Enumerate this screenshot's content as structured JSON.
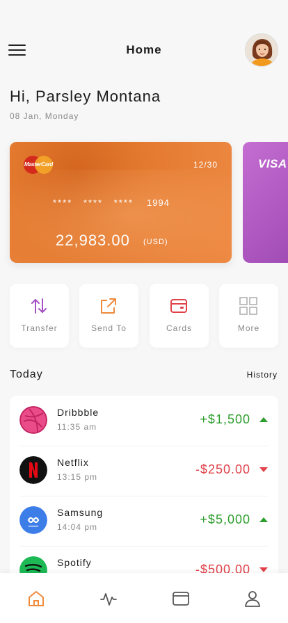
{
  "header": {
    "title": "Home"
  },
  "greeting": {
    "text": "Hi, Parsley Montana",
    "date": "08 Jan, Monday"
  },
  "cards": [
    {
      "brand": "MasterCard",
      "expiry": "12/30",
      "masked": "**** **** ****",
      "last4": "1994",
      "balance": "22,983.00",
      "currency": "(USD)"
    },
    {
      "brand": "VISA"
    }
  ],
  "actions": [
    {
      "label": "Transfer",
      "icon": "transfer-icon"
    },
    {
      "label": "Send To",
      "icon": "send-to-icon"
    },
    {
      "label": "Cards",
      "icon": "cards-icon"
    },
    {
      "label": "More",
      "icon": "more-grid-icon"
    }
  ],
  "today": {
    "title": "Today",
    "history_label": "History"
  },
  "transactions": [
    {
      "name": "Dribbble",
      "time": "11:35 am",
      "amount": "+$1,500",
      "direction": "up"
    },
    {
      "name": "Netflix",
      "time": "13:15 pm",
      "amount": "-$250.00",
      "direction": "down"
    },
    {
      "name": "Samsung",
      "time": "14:04 pm",
      "amount": "+$5,000",
      "direction": "up"
    },
    {
      "name": "Spotify",
      "time": "",
      "amount": "-$500.00",
      "direction": "down"
    }
  ],
  "nav": [
    {
      "icon": "home-icon",
      "active": true
    },
    {
      "icon": "activity-icon",
      "active": false
    },
    {
      "icon": "wallet-icon",
      "active": false
    },
    {
      "icon": "profile-icon",
      "active": false
    }
  ],
  "colors": {
    "accent": "#ef8a3c",
    "positive": "#2e9e2e",
    "negative": "#e0424a",
    "transfer_icon": "#a44fc3",
    "send_icon": "#ef8a3c",
    "cards_icon": "#e0424a",
    "more_icon": "#b0b0b0"
  }
}
